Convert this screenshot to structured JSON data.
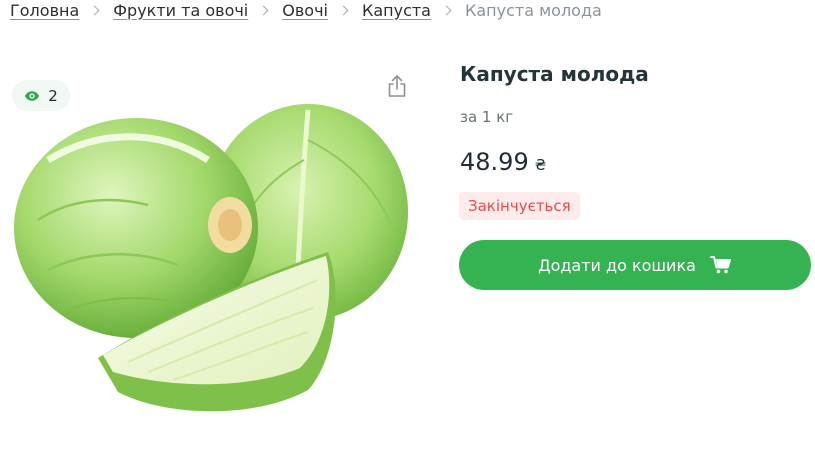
{
  "breadcrumb": {
    "items": [
      {
        "label": "Головна"
      },
      {
        "label": "Фрукти та овочі"
      },
      {
        "label": "Овочі"
      },
      {
        "label": "Капуста"
      }
    ],
    "current": "Капуста молода"
  },
  "views": {
    "count": "2",
    "icon": "eye-icon"
  },
  "share": {
    "icon": "share-icon"
  },
  "product": {
    "title": "Капуста молода",
    "unit": "за 1 кг",
    "price": "48.99",
    "currency": "₴",
    "stock_status": "Закінчується",
    "add_to_cart_label": "Додати до кошика",
    "cart_icon": "cart-icon"
  },
  "colors": {
    "accent": "#35b353",
    "stock_warning": "#e64c4c",
    "stock_warning_bg": "#fdeceb",
    "views_bg": "#f1f7f2"
  }
}
